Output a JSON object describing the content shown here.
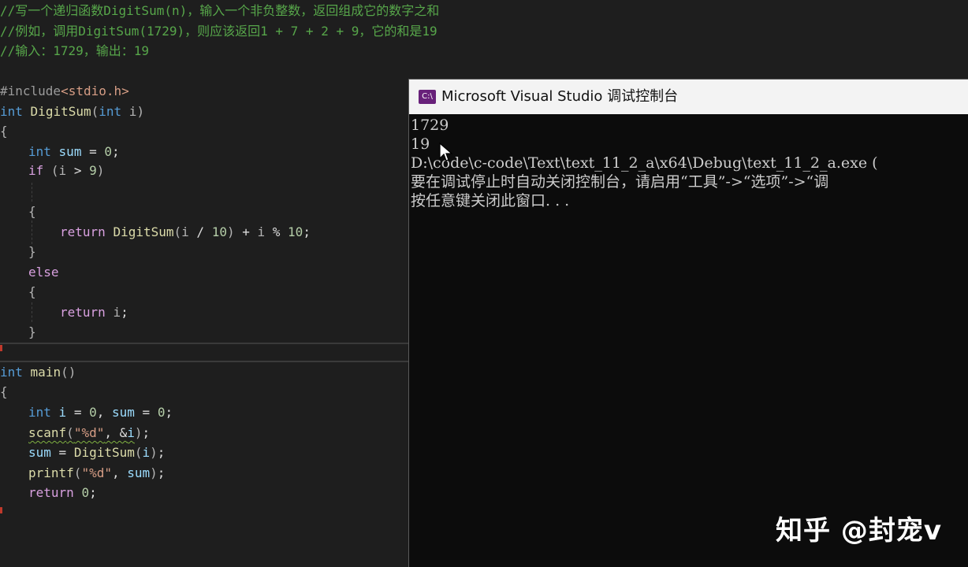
{
  "code_lines": {
    "l1": "//写一个递归函数DigitSum(n)，输入一个非负整数，返回组成它的数字之和",
    "l2": "//例如，调用DigitSum(1729)，则应该返回1 + 7 + 2 + 9，它的和是19",
    "l3": "//输入：1729，输出：19",
    "inc_hash": "#include",
    "inc_file": "<stdio.h>",
    "kw_int": "int",
    "fn_digitsum": "DigitSum",
    "param_i": "i",
    "open_brace": "{",
    "close_brace": "}",
    "var_sum": "sum",
    "num_0": "0",
    "kw_if": "if",
    "num_9": "9",
    "kw_return": "return",
    "num_10": "10",
    "kw_else": "else",
    "fn_main": "main",
    "fn_scanf": "scanf",
    "fn_printf": "printf",
    "str_fmt": "\"%d\""
  },
  "console": {
    "title": "Microsoft Visual Studio 调试控制台",
    "icon_text": "C:\\",
    "lines": [
      "1729",
      "19",
      "D:\\code\\c-code\\Text\\text_11_2_a\\x64\\Debug\\text_11_2_a.exe (",
      "要在调试停止时自动关闭控制台，请启用“工具”->“选项”->“调",
      "按任意键关闭此窗口. . ."
    ]
  },
  "watermark": "知乎 @封宠v",
  "colors": {
    "editor_bg": "#1e1e1e",
    "comment": "#57a64a",
    "keyword": "#569cd6",
    "control": "#d8a0df",
    "function": "#dcdcaa",
    "variable": "#9cdcfe",
    "number": "#b5cea8",
    "console_bg": "#0c0c0c",
    "vs_purple": "#68217a"
  }
}
